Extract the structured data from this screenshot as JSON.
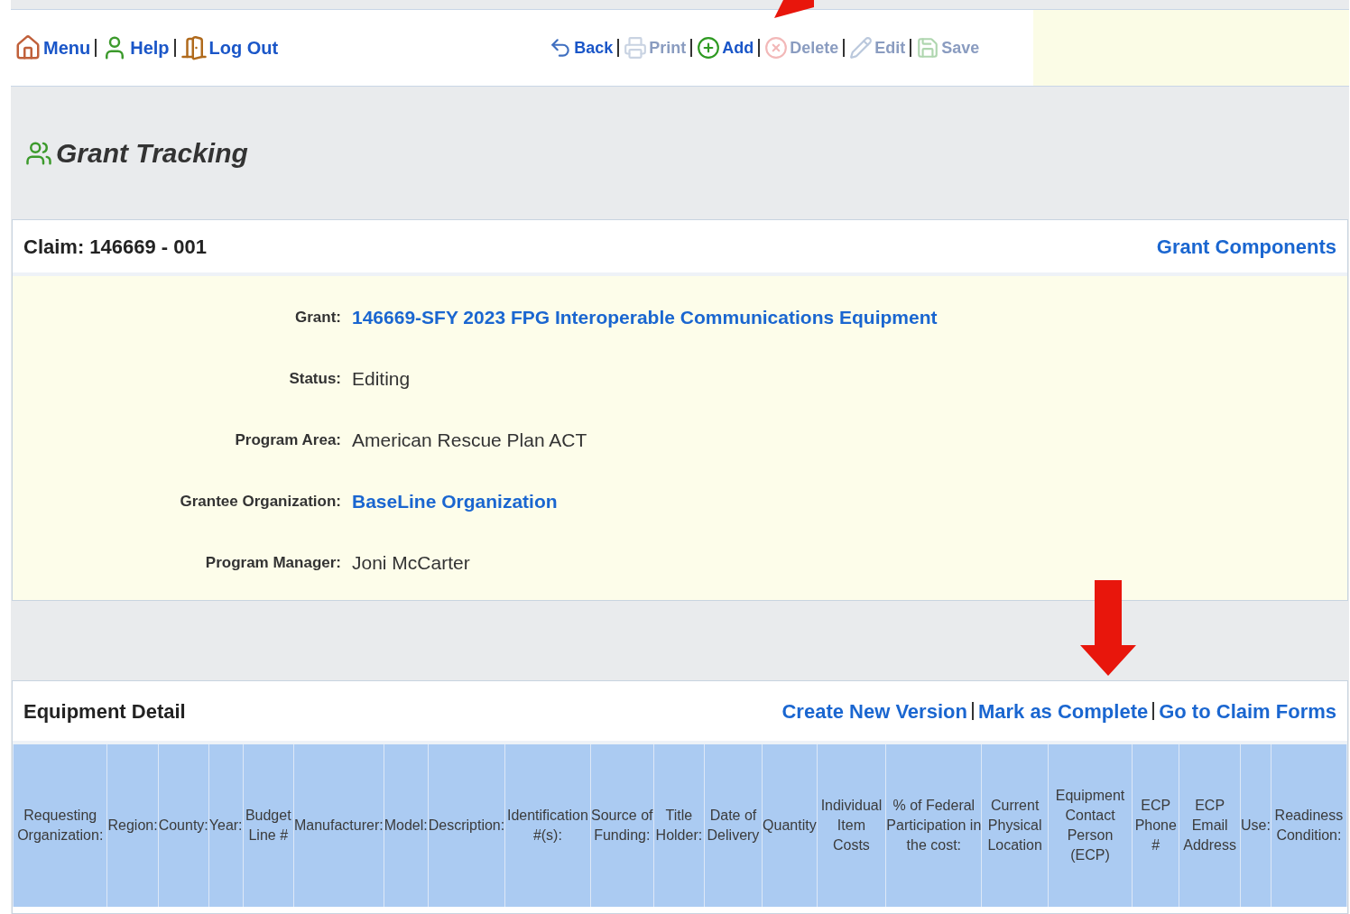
{
  "nav_left": [
    {
      "label": "Menu"
    },
    {
      "label": "Help"
    },
    {
      "label": "Log Out"
    }
  ],
  "toolbar": [
    {
      "label": "Back",
      "disabled": false
    },
    {
      "label": "Print",
      "disabled": true
    },
    {
      "label": "Add",
      "disabled": false
    },
    {
      "label": "Delete",
      "disabled": true
    },
    {
      "label": "Edit",
      "disabled": true
    },
    {
      "label": "Save",
      "disabled": true
    }
  ],
  "page_title": "Grant Tracking",
  "claim_panel": {
    "title": "Claim: 146669 - 001",
    "links": [
      "Grant Components"
    ],
    "fields": [
      {
        "label": "Grant:",
        "value": "146669-SFY 2023 FPG Interoperable Communications Equipment",
        "link": true
      },
      {
        "label": "Status:",
        "value": "Editing",
        "link": false
      },
      {
        "label": "Program Area:",
        "value": "American Rescue Plan ACT",
        "link": false
      },
      {
        "label": "Grantee Organization:",
        "value": "BaseLine Organization",
        "link": true
      },
      {
        "label": "Program Manager:",
        "value": "Joni McCarter",
        "link": false
      }
    ]
  },
  "equipment_panel": {
    "title": "Equipment Detail",
    "links": [
      "Create New Version",
      "Mark as Complete",
      "Go to Claim Forms"
    ],
    "table": {
      "columns": [
        "Requesting Organization:",
        "Region:",
        "County:",
        "Year:",
        "Budget Line #",
        "Manufacturer:",
        "Model:",
        "Description:",
        "Identification #(s):",
        "Source of Funding:",
        "Title Holder:",
        "Date of Delivery",
        "Quantity",
        "Individual Item Costs",
        "% of Federal Participation in the cost:",
        "Current Physical Location",
        "Equipment Contact Person (ECP)",
        "ECP Phone #",
        "ECP Email Address",
        "Use:",
        "Readiness Condition:"
      ]
    }
  }
}
